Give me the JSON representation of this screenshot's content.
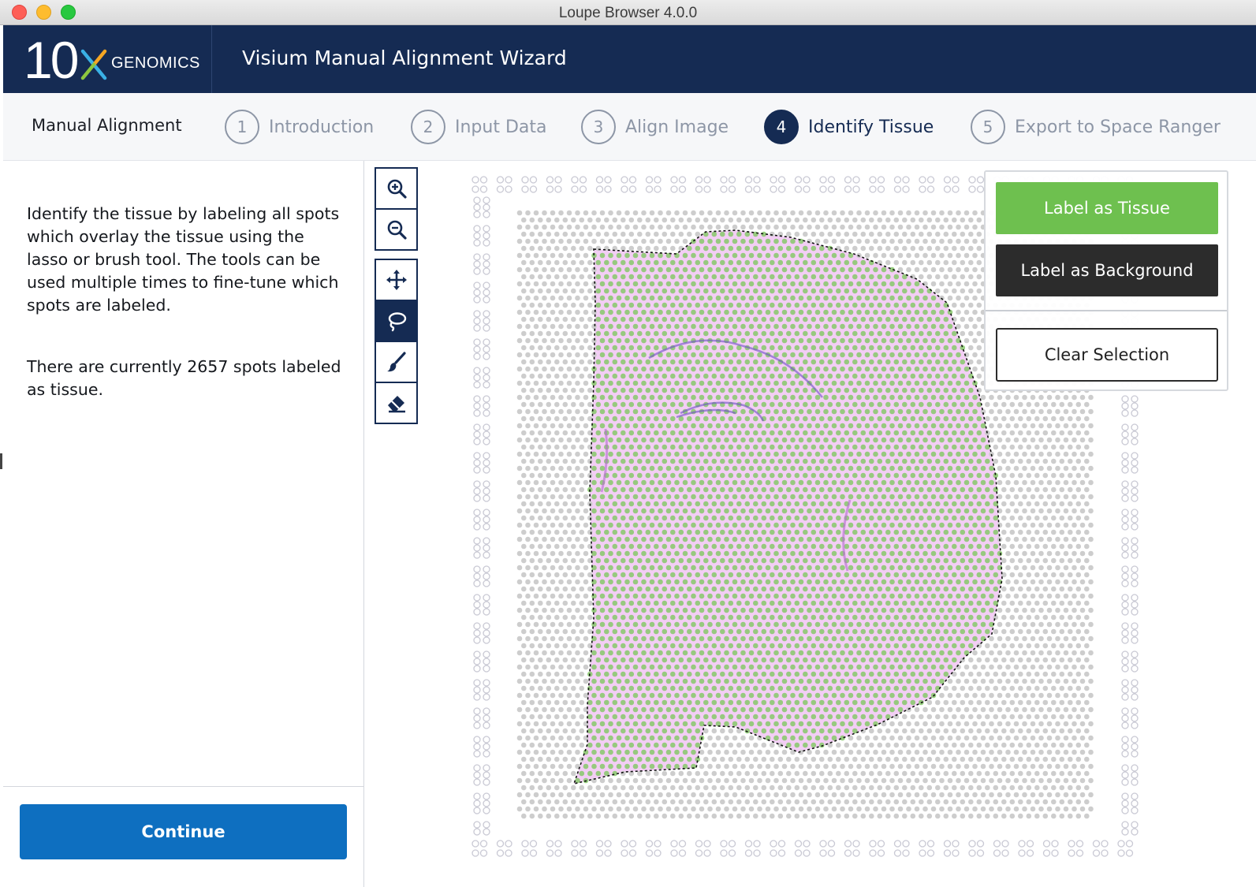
{
  "window": {
    "title": "Loupe Browser 4.0.0"
  },
  "header": {
    "logo_number": "10",
    "logo_text": "GENOMICS",
    "app_title": "Visium Manual Alignment Wizard"
  },
  "stepbar": {
    "title": "Manual Alignment",
    "steps": [
      {
        "number": "1",
        "label": "Introduction",
        "active": false
      },
      {
        "number": "2",
        "label": "Input Data",
        "active": false
      },
      {
        "number": "3",
        "label": "Align Image",
        "active": false
      },
      {
        "number": "4",
        "label": "Identify Tissue",
        "active": true
      },
      {
        "number": "5",
        "label": "Export to Space Ranger",
        "active": false
      }
    ]
  },
  "left_panel": {
    "instructions": "Identify the tissue by labeling all spots which overlay the tissue using the lasso or brush tool. The tools can be used multiple times to fine-tune which spots are labeled.",
    "status": "There are currently 2657 spots labeled as tissue.",
    "continue_label": "Continue"
  },
  "toolbar": {
    "tools": [
      {
        "icon": "zoom-in-icon",
        "active": false
      },
      {
        "icon": "zoom-out-icon",
        "active": false
      },
      {
        "icon": "move-icon",
        "active": false
      },
      {
        "icon": "lasso-icon",
        "active": true
      },
      {
        "icon": "brush-icon",
        "active": false
      },
      {
        "icon": "eraser-icon",
        "active": false
      }
    ]
  },
  "actions": {
    "label_tissue": "Label as Tissue",
    "label_background": "Label as Background",
    "clear_selection": "Clear Selection"
  },
  "colors": {
    "navy": "#152b53",
    "tissue_green": "#6ec04f",
    "continue_blue": "#0e6fc0",
    "tissue_stain": "#e27de6"
  }
}
